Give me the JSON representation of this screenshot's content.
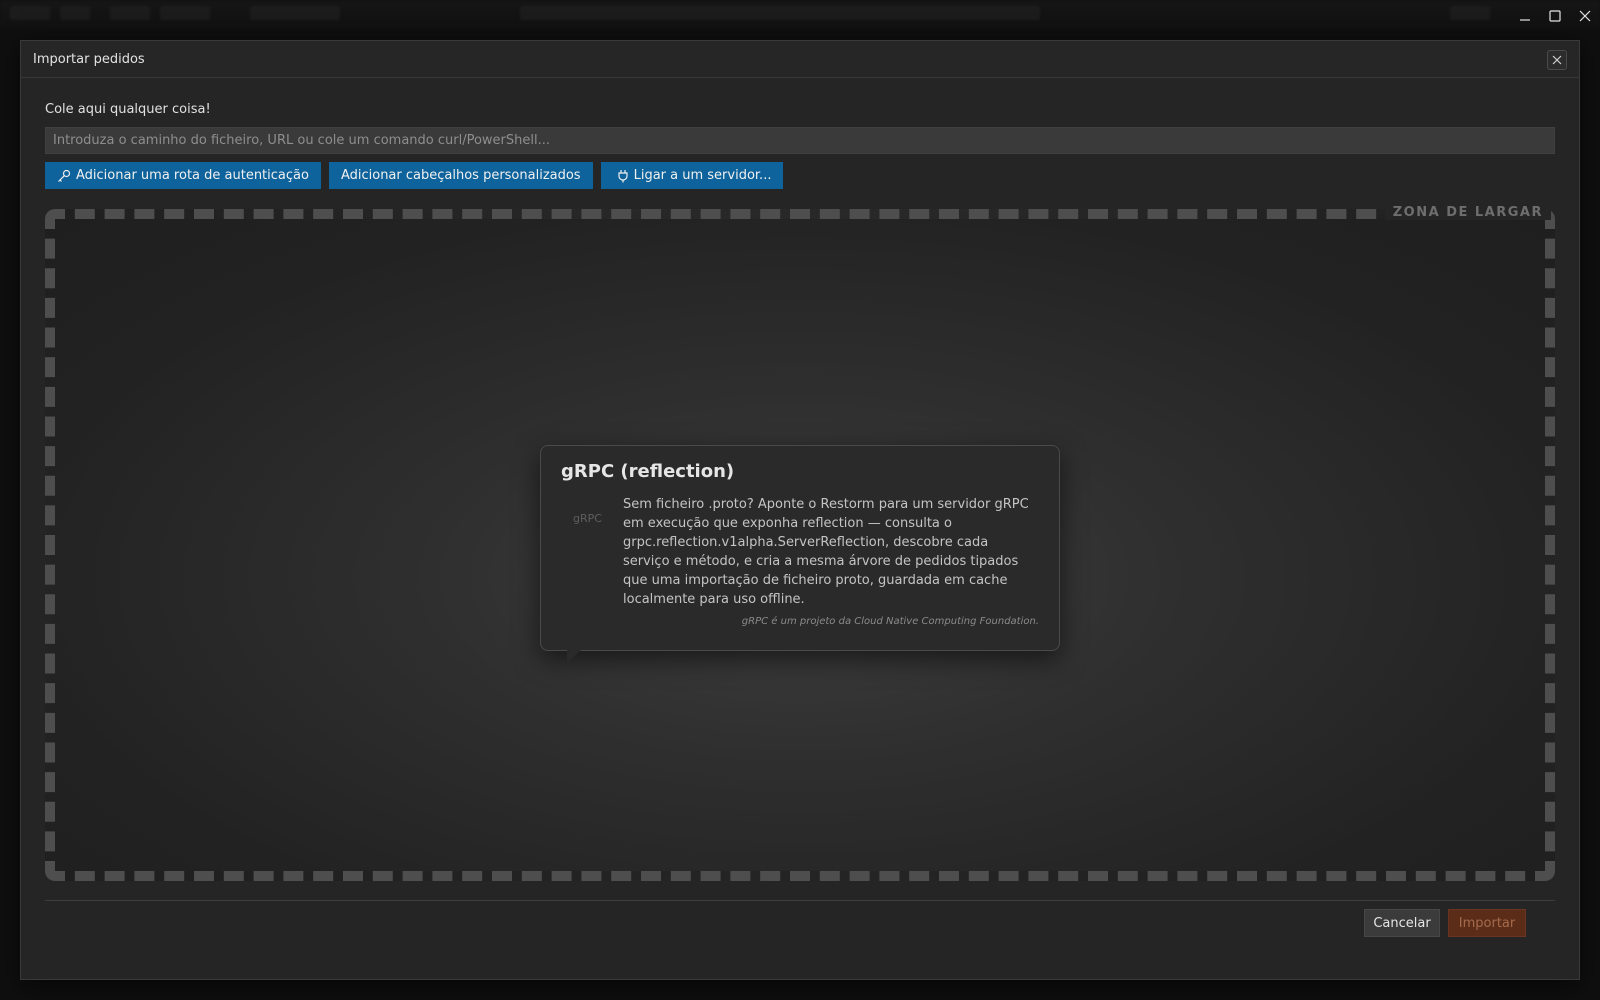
{
  "window": {
    "minimize_glyph": "–",
    "maximize_glyph": "☐",
    "close_glyph": "✕"
  },
  "dialog": {
    "title": "Importar pedidos",
    "close_glyph": "✕",
    "paste_label": "Cole aqui qualquer coisa!",
    "input": {
      "value": "",
      "placeholder": "Introduza o caminho do ficheiro, URL ou cole um comando curl/PowerShell..."
    },
    "buttons": {
      "auth_route": "Adicionar uma rota de autenticação",
      "custom_headers": "Adicionar cabeçalhos personalizados",
      "connect_server": "Ligar a um servidor..."
    },
    "drop_zone": {
      "label": "ZONA DE LARGAR"
    },
    "info_card": {
      "title": "gRPC (reflection)",
      "logo_text": "gRPC",
      "body": "Sem ficheiro .proto? Aponte o Restorm para um servidor gRPC em execução que exponha reflection — consulta o grpc.reflection.v1alpha.ServerReflection, descobre cada serviço e método, e cria a mesma árvore de pedidos tipados que uma importação de ficheiro proto, guardada em cache localmente para uso offline.",
      "footer": "gRPC é um projeto da Cloud Native Computing Foundation."
    },
    "footer": {
      "cancel": "Cancelar",
      "import": "Importar"
    }
  },
  "colors": {
    "primary_button": "#0e639c",
    "import_button_disabled": "#5b2d18",
    "dialog_bg": "#252525"
  }
}
